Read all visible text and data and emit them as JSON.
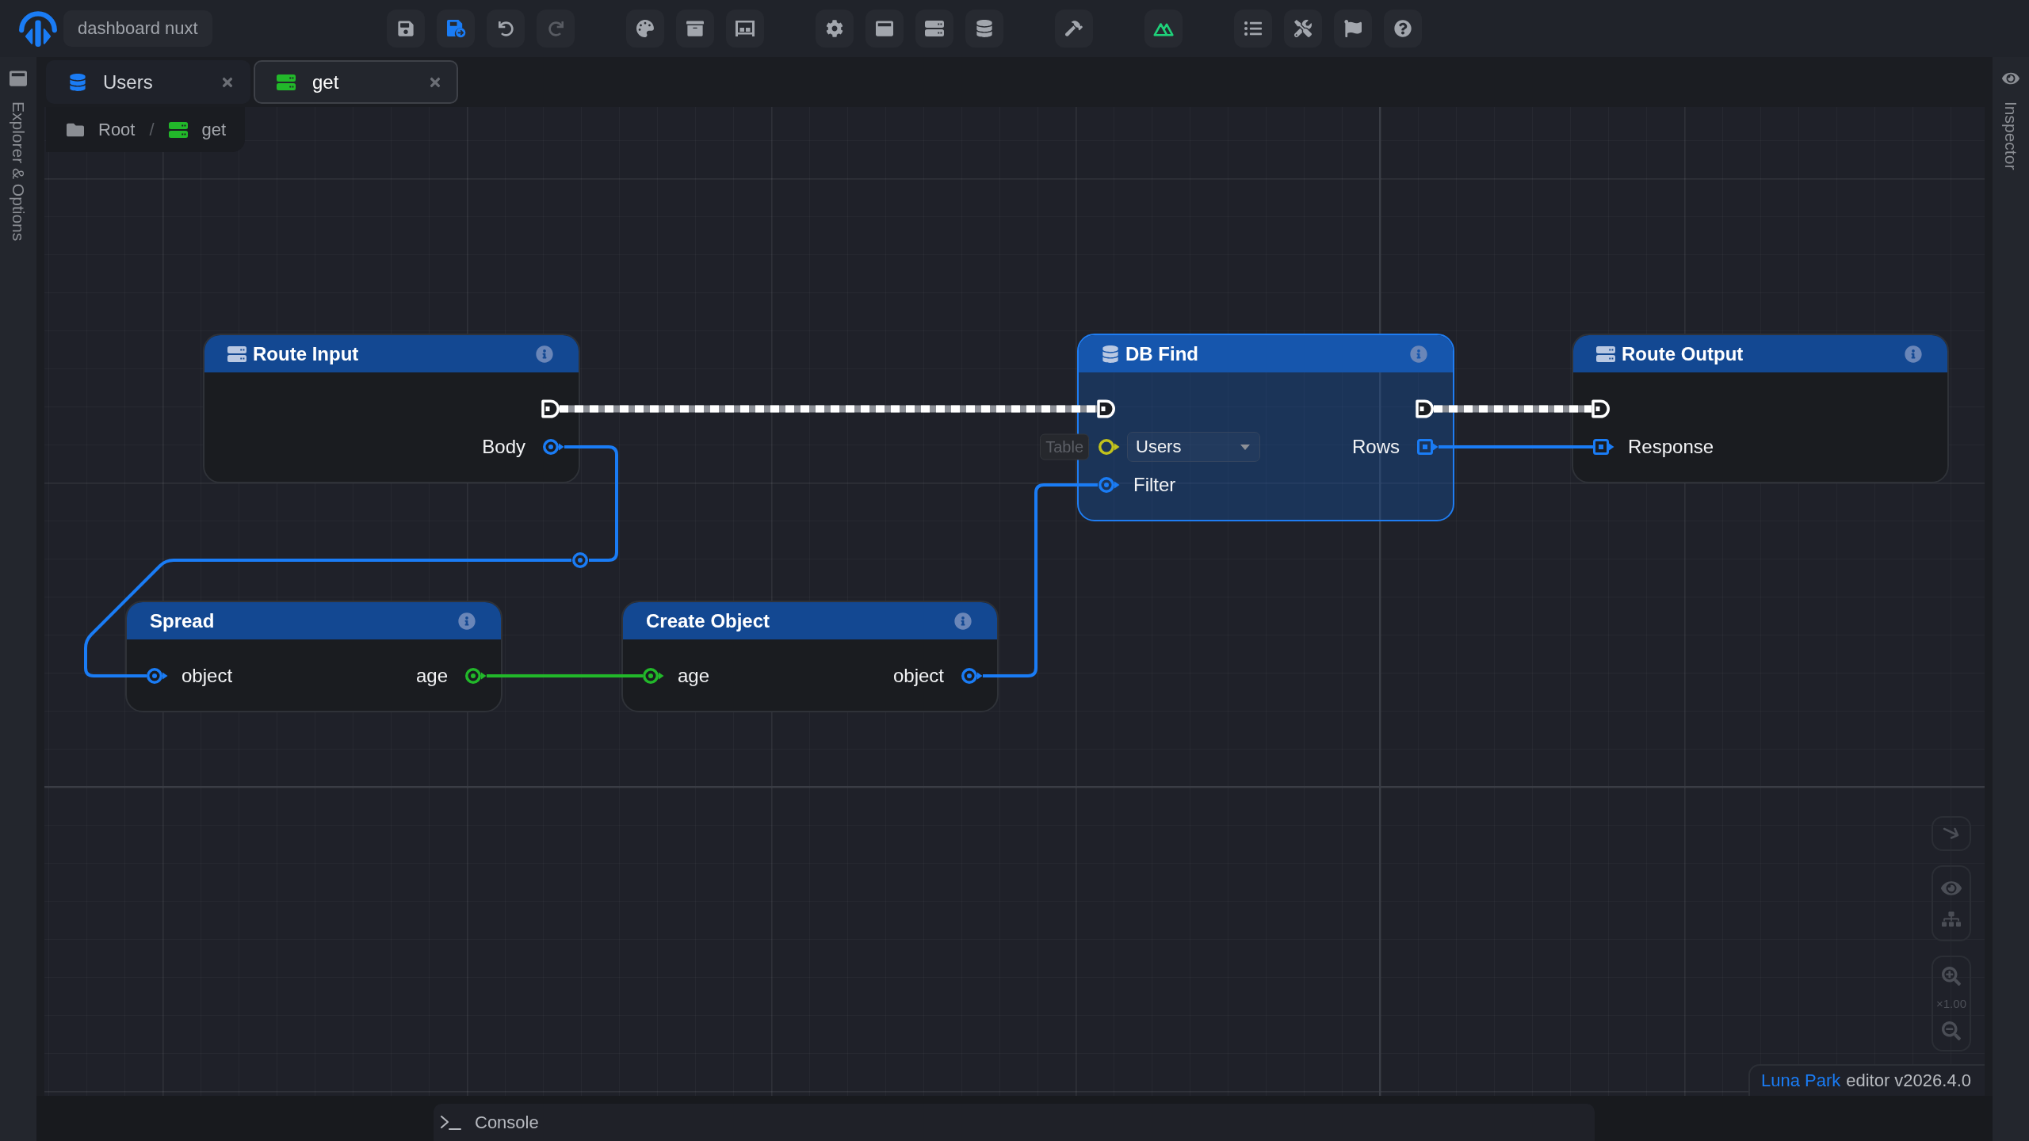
{
  "app_bar": {
    "project": "dashboard nuxt",
    "toolbar": [
      [
        {
          "kind": "save",
          "active": false,
          "disabled": false
        },
        {
          "kind": "save-as",
          "active": true,
          "disabled": false
        },
        {
          "kind": "undo",
          "active": false,
          "disabled": false
        },
        {
          "kind": "redo",
          "active": false,
          "disabled": true
        }
      ],
      [
        {
          "kind": "palette",
          "active": false,
          "disabled": false
        },
        {
          "kind": "archive",
          "active": false,
          "disabled": false
        },
        {
          "kind": "shelf",
          "active": false,
          "disabled": false
        }
      ],
      [
        {
          "kind": "settings",
          "active": false,
          "disabled": false
        },
        {
          "kind": "window",
          "active": false,
          "disabled": false
        },
        {
          "kind": "server",
          "active": false,
          "disabled": false
        },
        {
          "kind": "database",
          "active": false,
          "disabled": false
        }
      ],
      [
        {
          "kind": "build",
          "active": false,
          "disabled": false
        }
      ],
      [
        {
          "kind": "mountains",
          "active": false,
          "disabled": false
        }
      ],
      [
        {
          "kind": "list",
          "active": false,
          "disabled": false
        },
        {
          "kind": "tools",
          "active": false,
          "disabled": false
        },
        {
          "kind": "flag",
          "active": false,
          "disabled": false
        },
        {
          "kind": "help",
          "active": false,
          "disabled": false
        }
      ]
    ]
  },
  "explorer_panel": {
    "label": "Explorer & Options"
  },
  "tabs": [
    {
      "label": "Users",
      "kind": "database",
      "selected": false
    },
    {
      "label": "get",
      "kind": "route",
      "selected": true
    }
  ],
  "inspector_panel": {
    "label": "Inspector"
  },
  "breadcrumb": {
    "items": [
      {
        "label": "Root",
        "kind": "folder"
      },
      {
        "label": "get",
        "kind": "route"
      }
    ],
    "separator": "/"
  },
  "graph": {
    "nodes": [
      {
        "title": "Route Input",
        "kind": "route",
        "selected": false,
        "rows": [
          {
            "output": {
              "kind": "exec",
              "connected": true
            }
          },
          {
            "output": {
              "kind": "circle",
              "label": "Body",
              "color": "#1a7cf5",
              "connected": true
            }
          }
        ]
      },
      {
        "title": "DB Find",
        "kind": "database",
        "selected": true,
        "rows": [
          {
            "input": {
              "kind": "exec",
              "connected": true
            },
            "output": {
              "kind": "exec",
              "connected": true
            }
          },
          {
            "input": {
              "kind": "circle",
              "hint": "Table",
              "value": "Users",
              "color": "#c2c21c",
              "connected": false
            },
            "output": {
              "kind": "square",
              "label": "Rows",
              "color": "#1a7cf5",
              "connected": true
            }
          },
          {
            "input": {
              "kind": "circle",
              "label": "Filter",
              "color": "#1a7cf5",
              "connected": true
            }
          }
        ]
      },
      {
        "title": "Route Output",
        "kind": "route",
        "selected": false,
        "rows": [
          {
            "input": {
              "kind": "exec",
              "connected": true
            }
          },
          {
            "input": {
              "kind": "square",
              "label": "Response",
              "color": "#1a7cf5",
              "connected": true
            }
          }
        ]
      },
      {
        "title": "Spread",
        "kind": "function",
        "selected": false,
        "rows": [
          {
            "input": {
              "kind": "circle",
              "label": "object",
              "color": "#1a7cf5",
              "connected": true
            },
            "output": {
              "kind": "circle",
              "label": "age",
              "color": "#22b82a",
              "connected": true
            }
          }
        ]
      },
      {
        "title": "Create Object",
        "kind": "function",
        "selected": false,
        "rows": [
          {
            "input": {
              "kind": "circle",
              "label": "age",
              "color": "#22b82a",
              "connected": true
            },
            "output": {
              "kind": "circle",
              "label": "object",
              "color": "#1a7cf5",
              "connected": true
            }
          }
        ]
      }
    ],
    "wires": [
      {
        "kind": "exec"
      },
      {
        "kind": "exec"
      },
      {
        "kind": "data",
        "color": "#1a7cf5"
      },
      {
        "kind": "data",
        "color": "#22b82a"
      },
      {
        "kind": "data",
        "color": "#1a7cf5"
      },
      {
        "kind": "data",
        "color": "#1a7cf5"
      }
    ],
    "reroutes": [
      {
        "color": "#1a7cf5"
      }
    ]
  },
  "canvas_controls": {
    "zoom_level": "×1.00"
  },
  "version": {
    "brand": "Luna Park",
    "text": "editor v2026.4.0"
  },
  "console": {
    "label": "Console"
  }
}
